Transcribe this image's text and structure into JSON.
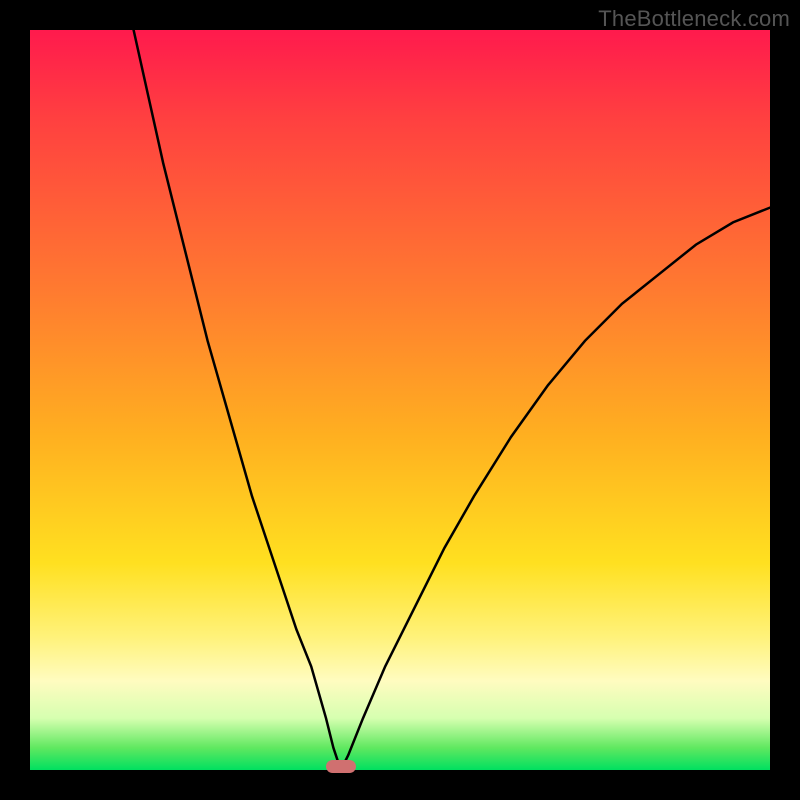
{
  "attribution": "TheBottleneck.com",
  "chart_data": {
    "type": "line",
    "title": "",
    "xlabel": "",
    "ylabel": "",
    "xlim": [
      0,
      100
    ],
    "ylim": [
      0,
      100
    ],
    "grid": false,
    "legend": false,
    "note": "V-shaped curve with a cusp near x≈42; gradient background encodes value (red high → green low). Small rounded marker sits at the minimum.",
    "series": [
      {
        "name": "curve",
        "x": [
          14,
          16,
          18,
          20,
          22,
          24,
          26,
          28,
          30,
          32,
          34,
          36,
          38,
          40,
          41,
          42,
          43,
          45,
          48,
          52,
          56,
          60,
          65,
          70,
          75,
          80,
          85,
          90,
          95,
          100
        ],
        "values": [
          100,
          91,
          82,
          74,
          66,
          58,
          51,
          44,
          37,
          31,
          25,
          19,
          14,
          7,
          3,
          0,
          2,
          7,
          14,
          22,
          30,
          37,
          45,
          52,
          58,
          63,
          67,
          71,
          74,
          76
        ]
      }
    ],
    "marker": {
      "x": 42,
      "y": 0,
      "color": "#d07070"
    },
    "gradient_stops": [
      {
        "pos": 0,
        "color": "#ff1a4d"
      },
      {
        "pos": 12,
        "color": "#ff4040"
      },
      {
        "pos": 35,
        "color": "#ff7a30"
      },
      {
        "pos": 55,
        "color": "#ffb020"
      },
      {
        "pos": 72,
        "color": "#ffe020"
      },
      {
        "pos": 82,
        "color": "#fff27a"
      },
      {
        "pos": 88,
        "color": "#fffcc0"
      },
      {
        "pos": 93,
        "color": "#d6ffb0"
      },
      {
        "pos": 97,
        "color": "#60e860"
      },
      {
        "pos": 100,
        "color": "#00e060"
      }
    ]
  }
}
